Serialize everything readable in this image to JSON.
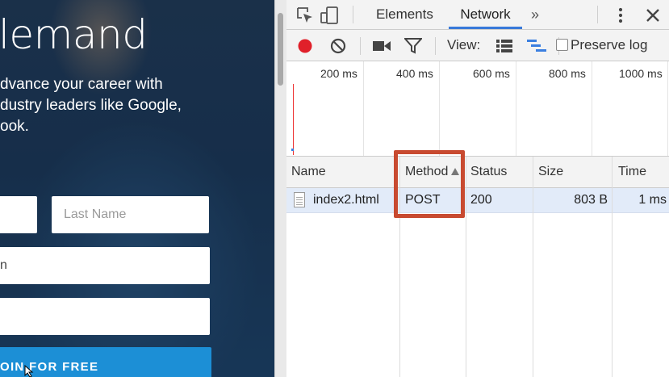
{
  "web_page": {
    "hero_title": "lemand",
    "hero_lines": [
      "dvance your career with",
      "dustry leaders like Google,",
      "ook."
    ],
    "first_name_placeholder": "",
    "last_name_placeholder": "Last Name",
    "email_partial": "n",
    "password_value": "",
    "join_button": "OIN FOR FREE"
  },
  "devtools": {
    "tabs": [
      "Elements",
      "Network"
    ],
    "active_tab": "Network",
    "more_tabs_glyph": "»",
    "toolbar": {
      "view_label": "View:",
      "preserve_log_label": "Preserve log",
      "preserve_log_checked": false,
      "recording": true
    },
    "overview_ticks": [
      "200 ms",
      "400 ms",
      "600 ms",
      "800 ms",
      "1000 ms"
    ],
    "columns": [
      "Name",
      "Method",
      "Status",
      "Size",
      "Time"
    ],
    "sorted_column": "Method",
    "rows": [
      {
        "name": "index2.html",
        "method": "POST",
        "status": "200",
        "size": "803 B",
        "time": "1 ms"
      }
    ]
  },
  "colors": {
    "record_red": "#e0202a",
    "active_tab_underline": "#3879d9",
    "highlight_box": "#c84a30",
    "selected_row": "#e2ebf9",
    "join_button": "#1c8fd6"
  },
  "icons": [
    "inspect-element-icon",
    "device-mode-icon",
    "more-tabs-icon",
    "kebab-menu-icon",
    "close-icon",
    "record-icon",
    "clear-icon",
    "camera-icon",
    "filter-icon",
    "list-view-icon",
    "waterfall-view-icon",
    "file-icon",
    "sort-ascending-icon"
  ]
}
